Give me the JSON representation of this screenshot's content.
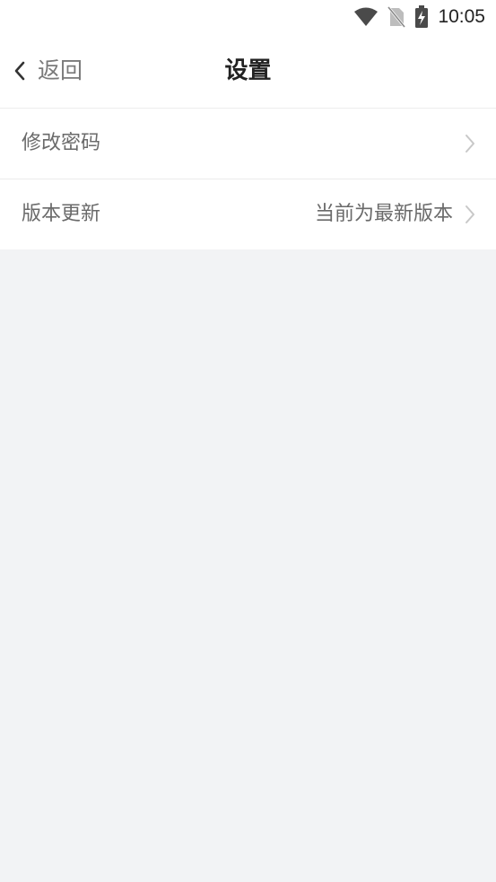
{
  "status_bar": {
    "time": "10:05",
    "icons": [
      "wifi-icon",
      "no-sim-icon",
      "battery-charging-icon"
    ]
  },
  "nav": {
    "back_label": "返回",
    "back_icon": "chevron-left-icon",
    "title": "设置"
  },
  "settings": {
    "items": [
      {
        "label": "修改密码",
        "value": "",
        "icon": "chevron-right-icon"
      },
      {
        "label": "版本更新",
        "value": "当前为最新版本",
        "icon": "chevron-right-icon"
      }
    ]
  },
  "colors": {
    "background": "#f2f3f5",
    "surface": "#ffffff",
    "title_text": "#222222",
    "secondary_text": "#6a6a6a",
    "chevron": "#c8c8c8",
    "divider": "#ebebeb"
  }
}
